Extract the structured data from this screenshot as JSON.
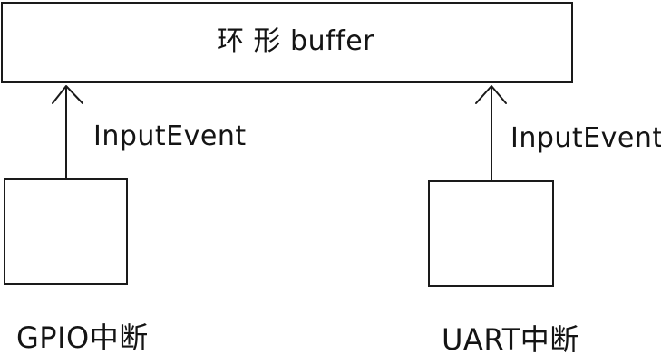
{
  "buffer": {
    "label": "环 形 buffer"
  },
  "left_branch": {
    "edge_label": "InputEvent",
    "source_label": "GPIO中断"
  },
  "right_branch": {
    "edge_label": "InputEvent",
    "source_label": "UART中断"
  }
}
